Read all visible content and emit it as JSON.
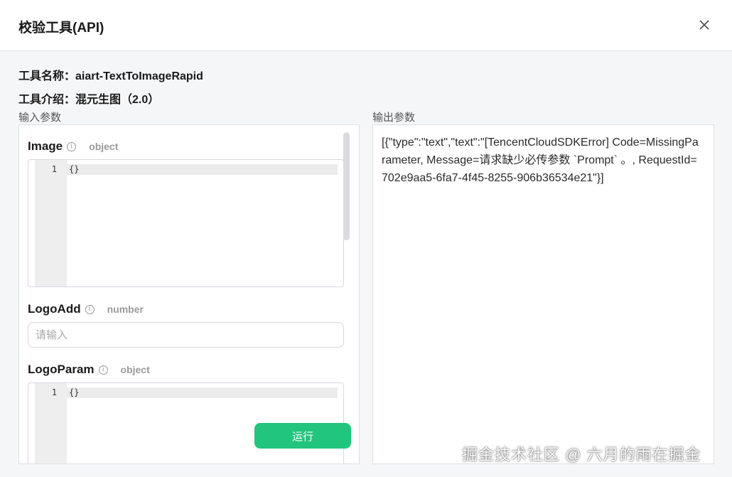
{
  "dialog": {
    "title": "校验工具(API)",
    "close_icon": "close-icon"
  },
  "info": {
    "tool_name": "工具名称：aiart-TextToImageRapid",
    "tool_intro": "工具介绍：混元生图（2.0）"
  },
  "input": {
    "section_label": "输入参数",
    "fields": [
      {
        "name": "Image",
        "type": "object",
        "line_no": "1",
        "code": "{}"
      },
      {
        "name": "LogoAdd",
        "type": "number",
        "placeholder": "请输入"
      },
      {
        "name": "LogoParam",
        "type": "object",
        "line_no": "1",
        "code": "{}"
      }
    ],
    "run_label": "运行"
  },
  "output": {
    "section_label": "输出参数",
    "text": "[{\"type\":\"text\",\"text\":\"[TencentCloudSDKError] Code=MissingParameter, Message=请求缺少必传参数 `Prompt` 。, RequestId=702e9aa5-6fa7-4f45-8255-906b36534e21\"}]"
  },
  "watermark": "掘金技术社区 @ 六月的雨在掘金",
  "colors": {
    "accent": "#22c57d",
    "background": "#f5f6f8",
    "panel": "#ffffff"
  }
}
